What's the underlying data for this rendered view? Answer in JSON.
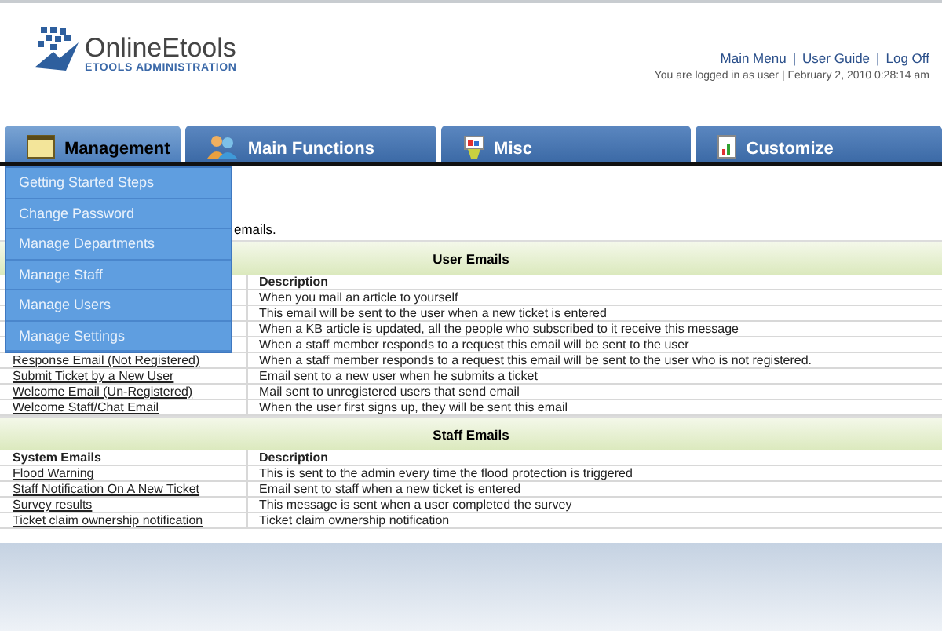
{
  "logo": {
    "name": "OnlineEtools",
    "subtitle": "ETOOLS ADMINISTRATION"
  },
  "header": {
    "links": [
      "Main Menu",
      "User Guide",
      "Log Off"
    ],
    "separator": "|",
    "status": "You are logged in as user | February 2, 2010 0:28:14 am"
  },
  "tabs": [
    {
      "label": "Management",
      "selected": true
    },
    {
      "label": "Main Functions",
      "selected": false
    },
    {
      "label": "Misc",
      "selected": false
    },
    {
      "label": "Customize",
      "selected": false
    }
  ],
  "menu": {
    "items": [
      "Getting Started Steps",
      "Change Password",
      "Manage Departments",
      "Manage Staff",
      "Manage Users",
      "Manage Settings"
    ]
  },
  "intro": "emails.",
  "sections": [
    {
      "title": "User Emails",
      "columns": [
        "",
        "Description"
      ],
      "rows": [
        {
          "description": "When you mail an article to yourself"
        },
        {
          "description": "This email will be sent to the user when a new ticket is entered"
        },
        {
          "description": "When a KB article is updated, all the people who subscribed to it receive this message"
        },
        {
          "description": "When a staff member responds to a request this email will be sent to the user"
        },
        {
          "name": "Response Email (Not Registered)",
          "description": "When a staff member responds to a request this email will be sent to the user who is not registered."
        },
        {
          "name": "Submit Ticket by a New User",
          "description": "Email sent to a new user when he submits a ticket"
        },
        {
          "name": "Welcome Email (Un-Registered)",
          "description": "Mail sent to unregistered users that send email"
        },
        {
          "name": "Welcome Staff/Chat Email",
          "description": "When the user first signs up, they will be sent this email"
        }
      ]
    },
    {
      "title": "Staff Emails",
      "columns": [
        "System Emails",
        "Description"
      ],
      "rows": [
        {
          "name": "Flood Warning",
          "description": "This is sent to the admin every time the flood protection is triggered"
        },
        {
          "name": "Staff Notification On A New Ticket",
          "description": "Email sent to staff when a new ticket is entered"
        },
        {
          "name": "Survey results",
          "description": "This message is sent when a user completed the survey"
        },
        {
          "name": "Ticket claim ownership notification",
          "description": "Ticket claim ownership notification"
        }
      ]
    }
  ]
}
